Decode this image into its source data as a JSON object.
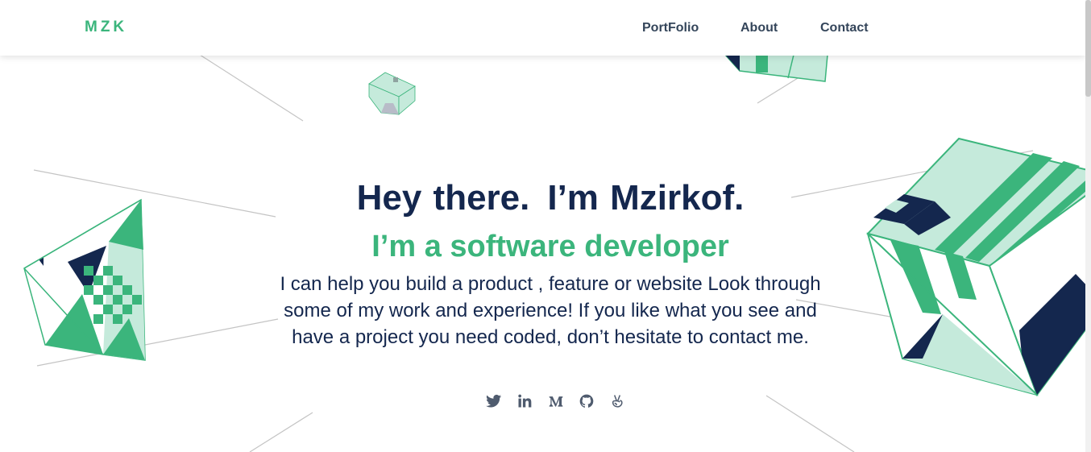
{
  "nav": {
    "logo": "MZK",
    "links": [
      {
        "label": "PortFolio"
      },
      {
        "label": "About"
      },
      {
        "label": "Contact"
      }
    ]
  },
  "hero": {
    "greeting": "Hey there.",
    "intro": "I’m Mzirkof.",
    "role": "I’m a software developer",
    "description": "I can help you build a product , feature or website Look through some of my work and experience! If you like what you see and have a project you need coded, don’t hesitate to contact me."
  },
  "socials": [
    {
      "icon": "twitter-icon"
    },
    {
      "icon": "linkedin-icon"
    },
    {
      "icon": "medium-icon"
    },
    {
      "icon": "github-icon"
    },
    {
      "icon": "angellist-icon"
    }
  ],
  "colors": {
    "accent": "#3bb57c",
    "navy": "#14274e",
    "mint": "#c5eadb",
    "line": "#bfbfbf"
  }
}
